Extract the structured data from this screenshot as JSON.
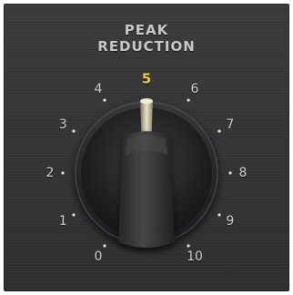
{
  "control": {
    "title_line1": "PEAK",
    "title_line2": "REDUCTION",
    "value": 5,
    "scale": [
      "0",
      "1",
      "2",
      "3",
      "4",
      "5",
      "6",
      "7",
      "8",
      "9",
      "10"
    ],
    "active_label": "5",
    "colors": {
      "panel": "#343537",
      "label": "#d2d2d4",
      "active_label": "#e8cf3a",
      "knob": "#2a2b2d"
    }
  }
}
